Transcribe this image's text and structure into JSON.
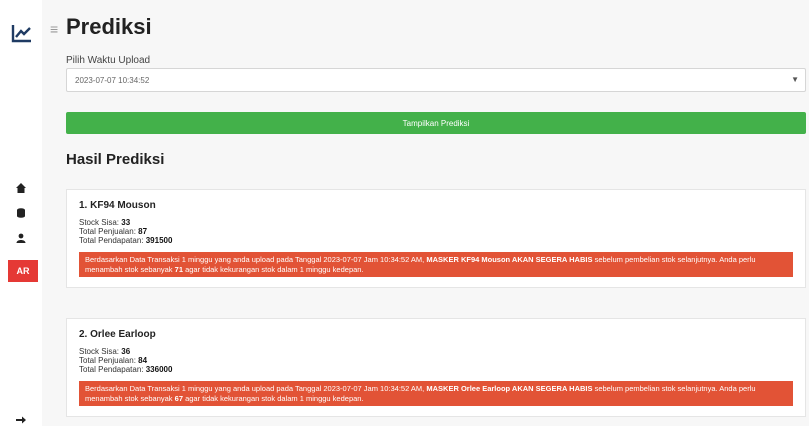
{
  "app": {
    "logo_icon": "chart-line-icon"
  },
  "sidebar": {
    "items": [
      {
        "icon": "home-icon"
      },
      {
        "icon": "database-icon"
      },
      {
        "icon": "user-icon"
      },
      {
        "icon": "active-menu-icon",
        "label": "AR"
      },
      {
        "icon": "logout-icon"
      }
    ],
    "active_color": "#e53935"
  },
  "page": {
    "title": "Prediksi"
  },
  "upload_select": {
    "label": "Pilih Waktu Upload",
    "value": "2023-07-07 10:34:52"
  },
  "predict_button": {
    "label": "Tampilkan Prediksi",
    "color": "#43b14a"
  },
  "results": {
    "title": "Hasil Prediksi",
    "stock_label": "Stock Sisa:",
    "sales_label": "Total Penjualan:",
    "income_label": "Total Pendapatan:",
    "items": [
      {
        "name": "1. KF94 Mouson",
        "stock": "33",
        "sales": "87",
        "income": "391500",
        "alert_pre": "Berdasarkan Data Transaksi 1 minggu yang anda upload pada Tanggal 2023-07-07 Jam 10:34:52 AM,",
        "alert_bold": "MASKER KF94 Mouson AKAN SEGERA HABIS",
        "alert_mid": "sebelum pembelian stok selanjutnya. Anda perlu menambah stok sebanyak",
        "alert_qty": "71",
        "alert_post": "agar tidak kekurangan stok dalam 1 minggu kedepan."
      },
      {
        "name": "2. Orlee Earloop",
        "stock": "36",
        "sales": "84",
        "income": "336000",
        "alert_pre": "Berdasarkan Data Transaksi 1 minggu yang anda upload pada Tanggal 2023-07-07 Jam 10:34:52 AM,",
        "alert_bold": "MASKER Orlee Earloop AKAN SEGERA HABIS",
        "alert_mid": "sebelum pembelian stok selanjutnya. Anda perlu menambah stok sebanyak",
        "alert_qty": "67",
        "alert_post": "agar tidak kekurangan stok dalam 1 minggu kedepan."
      }
    ],
    "alert_color": "#e25336"
  }
}
